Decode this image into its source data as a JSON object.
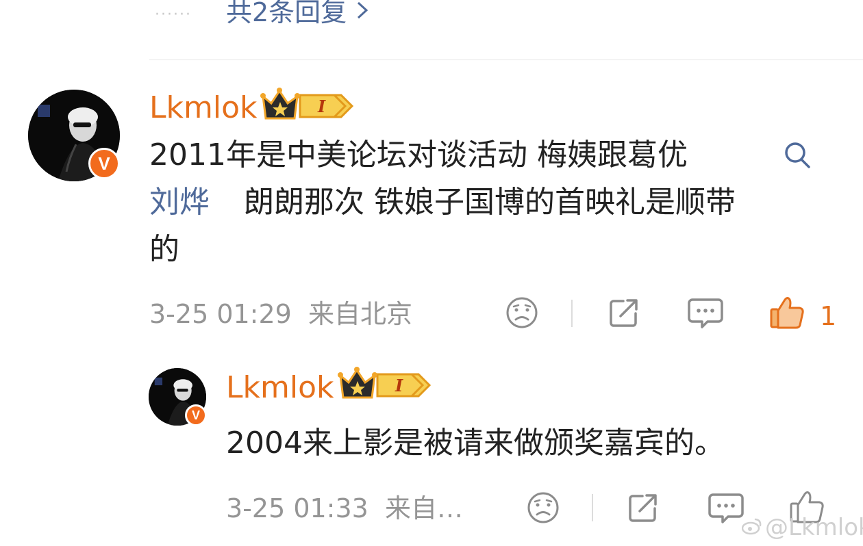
{
  "reply_thread": {
    "dots": "······",
    "more_replies_label": "共2条回复",
    "chevron_icon": "chevron-right-icon"
  },
  "comments": [
    {
      "username": "Lkmlok",
      "verified_badge": "V",
      "level_badge": "I",
      "text_line_1": "2011年是中美论坛对谈活动 梅姨跟葛优",
      "linked_name": "刘烨",
      "text_line_2": "朗朗那次 铁娘子国博的首映礼是顺带",
      "text_line_3": "的",
      "timestamp": "3-25 01:29",
      "location": "来自北京",
      "like_count": "1"
    },
    {
      "username": "Lkmlok",
      "verified_badge": "V",
      "level_badge": "I",
      "text": "2004来上影是被请来做颁奖嘉宾的。",
      "timestamp": "3-25 01:33",
      "location": "来自…"
    }
  ],
  "watermark": "@Lkmlok",
  "colors": {
    "username": "#e5701c",
    "link": "#4f6a9a",
    "meta": "#959595",
    "verified": "#f26b1d",
    "like_active": "#e5701c"
  }
}
